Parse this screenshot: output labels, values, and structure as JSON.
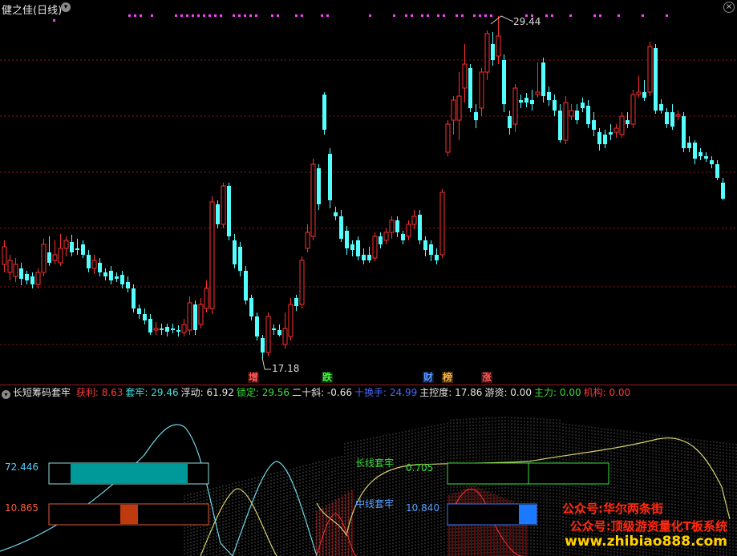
{
  "header": {
    "title": "健之佳(日线)",
    "dropdown_icon": "chevron-down-icon",
    "close_icon": "close-icon"
  },
  "price_annotations": {
    "high": "29.44",
    "low": "17.18"
  },
  "event_markers": [
    {
      "label": "增",
      "bg": "#3a1010",
      "fg": "#ff5a5a"
    },
    {
      "label": "跌",
      "bg": "#0d2a0d",
      "fg": "#3dff3d"
    },
    {
      "label": "财",
      "bg": "#0c1a3a",
      "fg": "#5a9aff"
    },
    {
      "label": "榜",
      "bg": "#3a2a0c",
      "fg": "#ffb040"
    },
    {
      "label": "涨",
      "bg": "#3a1010",
      "fg": "#ff5a5a"
    }
  ],
  "indicator": {
    "name": "长短筹码套牢",
    "items": [
      {
        "label": "获利:",
        "value": "8.63",
        "color": "#ff3b3b"
      },
      {
        "label": "套牢:",
        "value": "29.46",
        "color": "#40e0e0"
      },
      {
        "label": "浮动:",
        "value": "61.92",
        "color": "#e6e6e6"
      },
      {
        "label": "锁定:",
        "value": "29.56",
        "color": "#3dde3d"
      },
      {
        "label": "二十斜:",
        "value": "-0.66",
        "color": "#e6e6e6"
      },
      {
        "label": "十换手:",
        "value": "24.99",
        "color": "#4a6aff"
      },
      {
        "label": "主控度:",
        "value": "17.86",
        "color": "#e6e6e6"
      },
      {
        "label": "游资:",
        "value": "0.00",
        "color": "#e6e6e6"
      },
      {
        "label": "主力:",
        "value": "0.00",
        "color": "#3dde3d"
      },
      {
        "label": "机构:",
        "value": "0.00",
        "color": "#ff3b3b"
      }
    ]
  },
  "sub_panel": {
    "left_top_value": "72.446",
    "left_bottom_value": "10.865",
    "long_label": "长线套牢",
    "long_value": "0.705",
    "mid_label": "中线套牢",
    "mid_value": "10.840"
  },
  "watermarks": [
    "公众号:华尔两条街",
    "公众号:顶级游资量化T板系统",
    "www.zhibiao888.com"
  ],
  "colors": {
    "up": "#ff3030",
    "down": "#54ffff",
    "grid": "#8b1a1a",
    "top_dots": "#ff40ff"
  }
}
